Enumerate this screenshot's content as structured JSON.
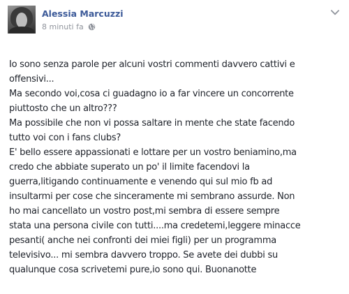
{
  "post": {
    "author": "Alessia Marcuzzi",
    "timestamp": "8 minuti fa",
    "privacy_icon": "globe-icon",
    "menu_icon": "chevron-down-icon",
    "avatar_icon": "profile-photo",
    "lines": [
      "Io sono senza parole per alcuni vostri commenti davvero cattivi e",
      "offensivi...",
      "Ma secondo voi,cosa ci guadagno io a far vincere un concorrente",
      "piuttosto che un altro???",
      "Ma possibile che non vi possa saltare in mente che state facendo",
      "tutto voi con i fans clubs?",
      "E' bello essere appassionati e lottare per un vostro beniamino,ma",
      "credo che abbiate superato un po' il limite facendovi la",
      "guerra,litigando continuamente e venendo qui sul mio fb ad",
      "insultarmi per cose che sinceramente mi sembrano assurde. Non",
      "ho mai cancellato un vostro post,mi sembra di essere sempre",
      "stata una persona civile con tutti....ma credetemi,leggere minacce",
      "pesanti( anche nei confronti dei miei figli) per un programma",
      "televisivo... mi sembra davvero troppo. Se avete dei dubbi su",
      "qualunque cosa scrivetemi pure,io sono qui. Buonanotte"
    ]
  },
  "colors": {
    "author": "#3b5998",
    "meta": "#90949c",
    "text": "#1d2129"
  }
}
